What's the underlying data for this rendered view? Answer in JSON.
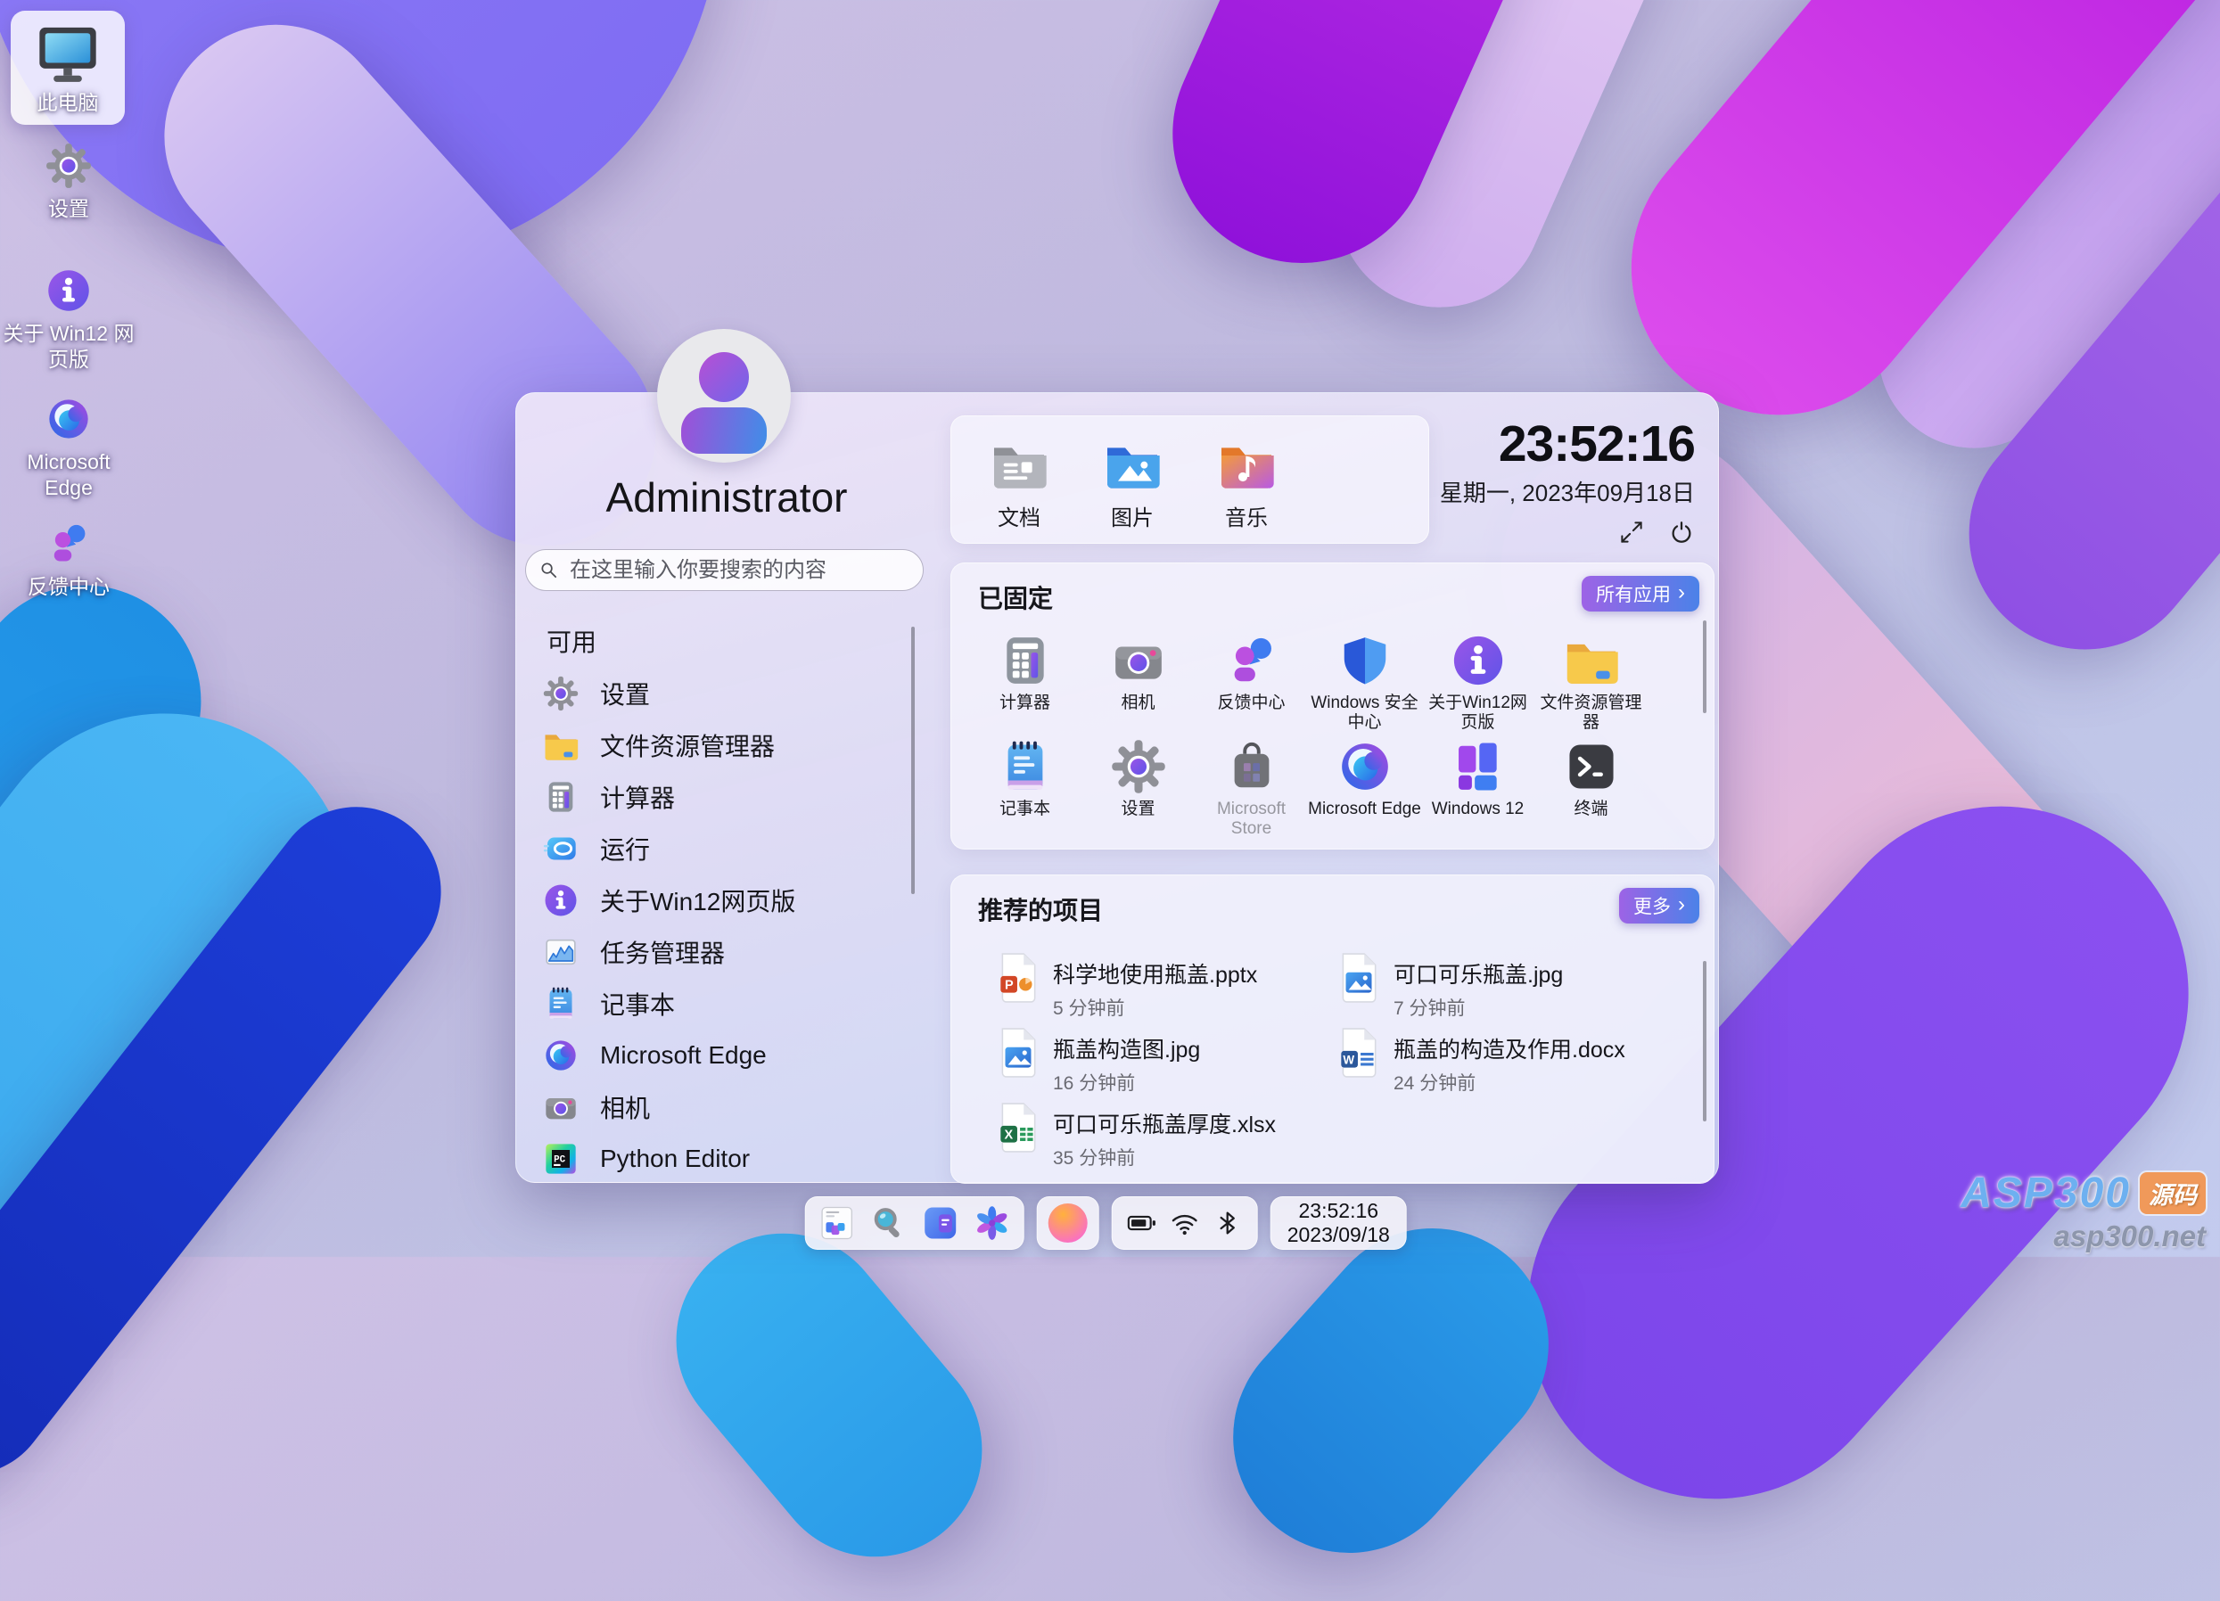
{
  "desktop": {
    "icons": [
      {
        "label": "此电脑",
        "icon": "computer-icon",
        "selected": true
      },
      {
        "label": "设置",
        "icon": "gear-icon"
      },
      {
        "label": "关于 Win12 网页版",
        "icon": "info-icon"
      },
      {
        "label": "Microsoft Edge",
        "icon": "edge-icon"
      },
      {
        "label": "反馈中心",
        "icon": "feedback-icon"
      }
    ]
  },
  "start_menu": {
    "user_name": "Administrator",
    "search_placeholder": "在这里输入你要搜索的内容",
    "available": {
      "title": "可用",
      "items": [
        {
          "label": "设置",
          "icon": "gear-icon"
        },
        {
          "label": "文件资源管理器",
          "icon": "folder-icon"
        },
        {
          "label": "计算器",
          "icon": "calculator-icon"
        },
        {
          "label": "运行",
          "icon": "run-icon"
        },
        {
          "label": "关于Win12网页版",
          "icon": "info-icon"
        },
        {
          "label": "任务管理器",
          "icon": "task-manager-icon"
        },
        {
          "label": "记事本",
          "icon": "notepad-icon"
        },
        {
          "label": "Microsoft Edge",
          "icon": "edge-icon"
        },
        {
          "label": "相机",
          "icon": "camera-icon"
        },
        {
          "label": "Python Editor",
          "icon": "python-editor-icon"
        }
      ]
    },
    "quick_access": {
      "items": [
        {
          "label": "文档",
          "icon": "documents-folder-icon"
        },
        {
          "label": "图片",
          "icon": "pictures-folder-icon"
        },
        {
          "label": "音乐",
          "icon": "music-folder-icon"
        }
      ]
    },
    "clock": {
      "time": "23:52:16",
      "date": "星期一, 2023年09月18日"
    },
    "pinned": {
      "title": "已固定",
      "all_apps_label": "所有应用",
      "items": [
        {
          "label": "计算器",
          "icon": "calculator-icon"
        },
        {
          "label": "相机",
          "icon": "camera-icon"
        },
        {
          "label": "反馈中心",
          "icon": "feedback-icon"
        },
        {
          "label": "Windows 安全中心",
          "icon": "security-shield-icon"
        },
        {
          "label": "关于Win12网页版",
          "icon": "info-icon"
        },
        {
          "label": "文件资源管理器",
          "icon": "folder-icon"
        },
        {
          "label": "记事本",
          "icon": "notepad-icon"
        },
        {
          "label": "设置",
          "icon": "gear-icon"
        },
        {
          "label": "Microsoft Store",
          "icon": "store-icon",
          "disabled": true
        },
        {
          "label": "Microsoft Edge",
          "icon": "edge-icon"
        },
        {
          "label": "Windows 12",
          "icon": "windows12-icon"
        },
        {
          "label": "终端",
          "icon": "terminal-icon"
        }
      ]
    },
    "recommended": {
      "title": "推荐的项目",
      "more_label": "更多",
      "items": [
        {
          "name": "科学地使用瓶盖.pptx",
          "time": "5 分钟前",
          "icon": "powerpoint-file-icon"
        },
        {
          "name": "可口可乐瓶盖.jpg",
          "time": "7 分钟前",
          "icon": "image-file-icon"
        },
        {
          "name": "瓶盖构造图.jpg",
          "time": "16 分钟前",
          "icon": "image-file-icon"
        },
        {
          "name": "瓶盖的构造及作用.docx",
          "time": "24 分钟前",
          "icon": "word-file-icon"
        },
        {
          "name": "可口可乐瓶盖厚度.xlsx",
          "time": "35 分钟前",
          "icon": "excel-file-icon"
        }
      ]
    }
  },
  "taskbar": {
    "clock": {
      "time": "23:52:16",
      "date": "2023/09/18"
    },
    "app_icons": [
      "start",
      "search",
      "widgets",
      "pinwheel"
    ],
    "tray_icons": [
      "battery",
      "wifi",
      "bluetooth"
    ],
    "launcher": "orange-orb"
  },
  "watermark": {
    "brand": "ASP300",
    "badge": "源码",
    "domain": "asp300.net"
  },
  "colors": {
    "accent_gradient_start": "#9d63e6",
    "accent_gradient_end": "#4b82e8",
    "menu_bg": "rgba(237,229,248,0.95)",
    "taskbar_bg": "rgba(243,242,250,0.92)"
  }
}
